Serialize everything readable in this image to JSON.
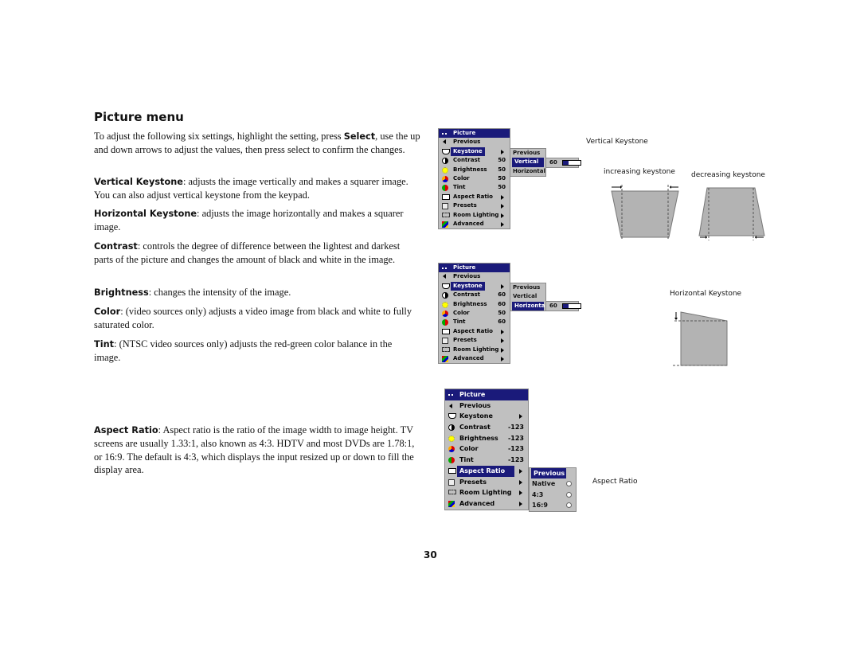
{
  "page": {
    "title": "Picture menu",
    "page_number": "30"
  },
  "paragraphs": {
    "intro": {
      "pre": "To adjust the following six settings, highlight the setting, press ",
      "bold": "Select",
      "post": ", use the up and down arrows to adjust the values, then press select to confirm the changes."
    },
    "vertical_keystone": {
      "term": "Vertical Keystone",
      "text": ": adjusts the image vertically and makes a squarer image. You can also adjust vertical keystone from the keypad."
    },
    "horizontal_keystone": {
      "term": "Horizontal Keystone",
      "text": ": adjusts the image horizontally and makes a squarer image."
    },
    "contrast": {
      "term": "Contrast",
      "text": ": controls the degree of difference between the lightest and darkest parts of the picture and changes the amount of black and white in the image."
    },
    "brightness": {
      "term": "Brightness",
      "text": ": changes the intensity of the image."
    },
    "color": {
      "term": "Color",
      "text": ": (video sources only) adjusts a video image from black and white to fully saturated color."
    },
    "tint": {
      "term": "Tint",
      "text": ": (NTSC video sources only) adjusts the red-green color balance in the image."
    },
    "aspect_ratio": {
      "term": "Aspect Ratio",
      "text": ": Aspect ratio is the ratio of the image width to image height. TV screens are usually 1.33:1, also known as 4:3. HDTV and most DVDs are 1.78:1, or 16:9. The default is 4:3, which displays the input resized up or down to fill the display area."
    }
  },
  "menu1": {
    "header": "Picture",
    "items": [
      {
        "label": "Previous",
        "value": ""
      },
      {
        "label": "Keystone",
        "value": ""
      },
      {
        "label": "Contrast",
        "value": "50"
      },
      {
        "label": "Brightness",
        "value": "50"
      },
      {
        "label": "Color",
        "value": "50"
      },
      {
        "label": "Tint",
        "value": "50"
      },
      {
        "label": "Aspect Ratio",
        "value": ""
      },
      {
        "label": "Presets",
        "value": ""
      },
      {
        "label": "Room Lighting",
        "value": ""
      },
      {
        "label": "Advanced",
        "value": ""
      }
    ],
    "submenu": [
      "Previous",
      "Vertical",
      "Horizontal"
    ],
    "slider_value": "60",
    "slider_fraction": 0.3
  },
  "menu2": {
    "header": "Picture",
    "items": [
      {
        "label": "Previous",
        "value": ""
      },
      {
        "label": "Keystone",
        "value": ""
      },
      {
        "label": "Contrast",
        "value": "60"
      },
      {
        "label": "Brightness",
        "value": "60"
      },
      {
        "label": "Color",
        "value": "50"
      },
      {
        "label": "Tint",
        "value": "60"
      },
      {
        "label": "Aspect Ratio",
        "value": ""
      },
      {
        "label": "Presets",
        "value": ""
      },
      {
        "label": "Room Lighting",
        "value": ""
      },
      {
        "label": "Advanced",
        "value": ""
      }
    ],
    "submenu": [
      "Previous",
      "Vertical",
      "Horizontal"
    ],
    "slider_value": "60",
    "slider_fraction": 0.3
  },
  "menu3": {
    "header": "Picture",
    "items": [
      {
        "label": "Previous",
        "value": ""
      },
      {
        "label": "Keystone",
        "value": ""
      },
      {
        "label": "Contrast",
        "value": "-123"
      },
      {
        "label": "Brightness",
        "value": "-123"
      },
      {
        "label": "Color",
        "value": "-123"
      },
      {
        "label": "Tint",
        "value": "-123"
      },
      {
        "label": "Aspect Ratio",
        "value": ""
      },
      {
        "label": "Presets",
        "value": ""
      },
      {
        "label": "Room Lighting",
        "value": ""
      },
      {
        "label": "Advanced",
        "value": ""
      }
    ],
    "submenu": [
      "Previous",
      "Native",
      "4:3",
      "16:9"
    ]
  },
  "captions": {
    "vertical_keystone": "Vertical Keystone",
    "increasing": "increasing keystone",
    "decreasing": "decreasing keystone",
    "horizontal_keystone": "Horizontal Keystone",
    "aspect_ratio": "Aspect Ratio"
  },
  "colors": {
    "menu_bg": "#c0c0c0",
    "highlight": "#1a1a7a",
    "diagram_fill": "#b3b3b3"
  }
}
